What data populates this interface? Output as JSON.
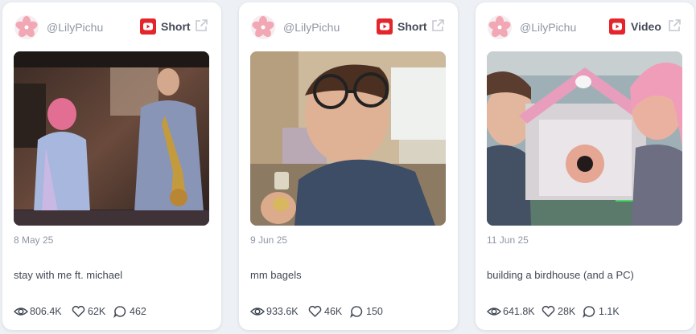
{
  "cards": [
    {
      "handle": "@LilyPichu",
      "type_label": "Short",
      "date": "8 May 25",
      "caption": "stay with me ft. michael",
      "views": "806.4K",
      "likes": "62K",
      "comments": "462",
      "platform_icon": "youtube-icon"
    },
    {
      "handle": "@LilyPichu",
      "type_label": "Short",
      "date": "9 Jun 25",
      "caption": "mm bagels",
      "views": "933.6K",
      "likes": "46K",
      "comments": "150",
      "platform_icon": "youtube-icon"
    },
    {
      "handle": "@LilyPichu",
      "type_label": "Video",
      "date": "11 Jun 25",
      "caption": "building a birdhouse (and a PC)",
      "views": "641.8K",
      "likes": "28K",
      "comments": "1.1K",
      "platform_icon": "youtube-icon"
    }
  ],
  "colors": {
    "youtube_red": "#e5252c",
    "avatar_pink": "#f2a7b5",
    "text_muted": "#8f96a3",
    "text_dark": "#424955"
  }
}
